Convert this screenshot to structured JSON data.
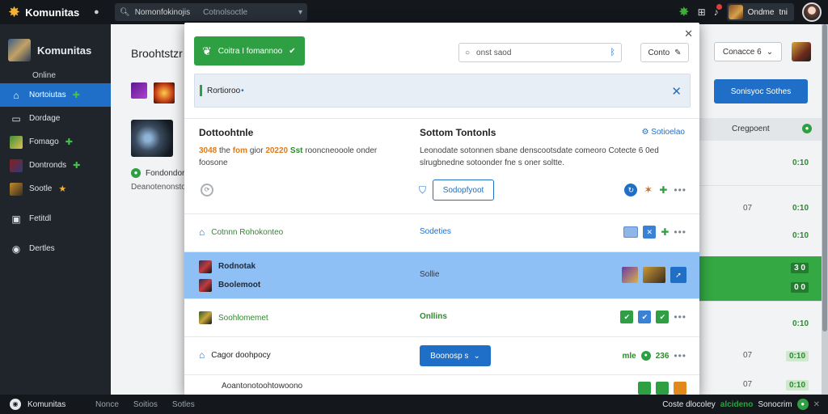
{
  "topbar": {
    "app_name": "Komunitas",
    "search_value": "Nomonfokinojis",
    "search_secondary": "Cotnolsoctle",
    "user_name": "Ondme",
    "user_extra": "tni"
  },
  "sidebar": {
    "brand": "Komunitas",
    "status": "Online",
    "items": [
      {
        "label": "Nortoiutas"
      },
      {
        "label": "Dordage"
      },
      {
        "label": "Fomago"
      },
      {
        "label": "Dontronds"
      },
      {
        "label": "Sootle"
      },
      {
        "label": "Fetitdl"
      },
      {
        "label": "Dertles"
      }
    ]
  },
  "background": {
    "title": "Broohtstzr",
    "online_label": "Fondondor",
    "desc": "Deanotenonsto",
    "right_button": "Conacce 6",
    "primary_button": "Sonisyoc Sothes",
    "column_header": "Cregpoent",
    "rows": [
      {
        "c": "",
        "v": "0:10"
      },
      {
        "c": "07",
        "v": "0:10"
      },
      {
        "c": "",
        "v": "0:10"
      },
      {
        "c": "",
        "v": "3 0",
        "v2": "0 0"
      },
      {
        "c": "",
        "v": "0:10"
      },
      {
        "c": "07",
        "v": "0:10"
      },
      {
        "c": "07",
        "v": "0:10"
      }
    ]
  },
  "modal": {
    "green_button": "Coitra I fomannoo",
    "search_placeholder": "onst saod",
    "small_button": "Conto",
    "alert_text": "Rortioroo",
    "section": {
      "left_title": "Dottoohtnle",
      "left_desc_1": "the",
      "left_desc_orange_1": "fom",
      "left_desc_mid": "gior",
      "left_desc_orange_2": "20220",
      "left_desc_green": "Sst",
      "left_desc_rest": "rooncneooole onder foosone",
      "left_desc_prefix": "3048",
      "right_title": "Sottom Tontonls",
      "right_link": "Sotioelao",
      "right_desc": "Leonodate sotonnen sbane denscootsdate comeoro Cotecte 6 0ed slrugbnedne sotoonder fne s oner soltte.",
      "outline_button": "Sodopfyoot"
    },
    "rows": [
      {
        "left": "Cotnnn Rohokonteo",
        "mid": "Sodeties"
      },
      {
        "left_1": "Rodnotak",
        "left_2": "Boolemoot",
        "mid": "Sollie"
      },
      {
        "left": "Soohlomemet",
        "mid": "Onllins"
      },
      {
        "left": "Cagor doohpocy",
        "button": "Boonosp s",
        "right_text": "mle",
        "right_value": "236"
      },
      {
        "left": "Aoantonotoohtowoono"
      }
    ]
  },
  "footer": {
    "brand": "Komunitas",
    "links": [
      "Nonce",
      "Soitios",
      "Sotles"
    ],
    "right_text": "Coste dlocoley",
    "right_green": "alcideno",
    "right_last": "Sonocrim"
  }
}
